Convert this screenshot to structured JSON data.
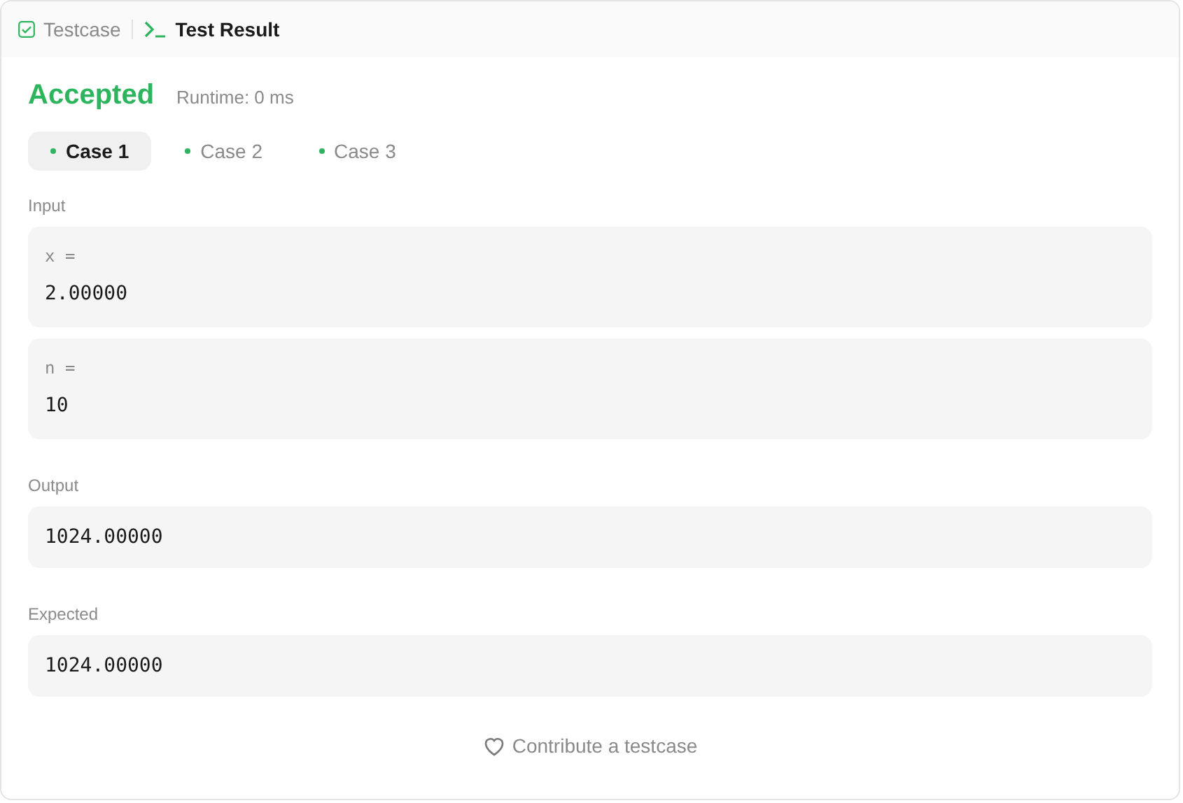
{
  "tabs": [
    {
      "label": "Testcase",
      "selected": false
    },
    {
      "label": "Test Result",
      "selected": true
    }
  ],
  "result": {
    "status": "Accepted",
    "runtime": "Runtime: 0 ms"
  },
  "cases": [
    {
      "label": "Case 1",
      "selected": true
    },
    {
      "label": "Case 2",
      "selected": false
    },
    {
      "label": "Case 3",
      "selected": false
    }
  ],
  "input": {
    "label": "Input",
    "params": [
      {
        "name": "x =",
        "value": "2.00000"
      },
      {
        "name": "n =",
        "value": "10"
      }
    ]
  },
  "output": {
    "label": "Output",
    "value": "1024.00000"
  },
  "expected": {
    "label": "Expected",
    "value": "1024.00000"
  },
  "contribute": "Contribute a testcase"
}
